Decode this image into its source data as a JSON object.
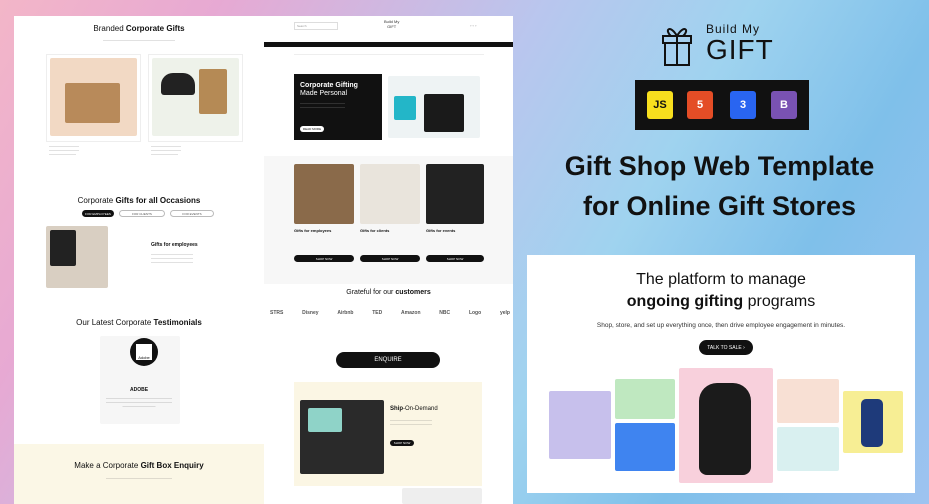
{
  "left_page": {
    "branded_title_a": "Branded",
    "branded_title_b": "Corporate Gifts",
    "occasions_title_a": "Corporate",
    "occasions_title_b": "Gifts for all Occasions",
    "occasion_tabs": [
      "FOR EMPLOYEES",
      "FOR CLIENTS",
      "FOR EVENTS"
    ],
    "employees_title": "Gifts for employees",
    "testimonials_title_a": "Our Latest Corporate",
    "testimonials_title_b": "Testimonials",
    "testimonial_company": "ADOBE",
    "testimonial_logo_text": "Adobe",
    "enquiry_title_a": "Make a Corporate",
    "enquiry_title_b": "Gift Box Enquiry"
  },
  "mid_page": {
    "search_placeholder": "Search",
    "logo_text_a": "Build My",
    "logo_text_b": "GIFT",
    "hero_title_a": "Corporate Gifting",
    "hero_title_b": "Made Personal",
    "hero_button": "READ MORE",
    "categories": [
      {
        "title": "Gifts for employees",
        "button": "SHOP NOW"
      },
      {
        "title": "Gifts for clients",
        "button": "SHOP NOW"
      },
      {
        "title": "Gifts for events",
        "button": "SHOP NOW"
      }
    ],
    "customers_title_a": "Grateful for our",
    "customers_title_b": "customers",
    "customer_logos": [
      "STRS",
      "Disney",
      "Airbnb",
      "TED",
      "Amazon",
      "NBC",
      "Logo",
      "yelp"
    ],
    "enquire_button": "ENQUIRE",
    "ship_title_a": "Ship",
    "ship_title_b": "-On-Demand",
    "ship_button": "SHOP NOW"
  },
  "brand": {
    "line1": "Build My",
    "line2": "GIFT"
  },
  "tech_badges": [
    {
      "label": "JS",
      "color": "#f7df1e"
    },
    {
      "label": "5",
      "color": "#e44d26"
    },
    {
      "label": "3",
      "color": "#2965f1"
    },
    {
      "label": "B",
      "color": "#7952b3"
    }
  ],
  "headline": {
    "line1": "Gift Shop Web Template",
    "line2": "for Online Gift Stores"
  },
  "platform": {
    "title_line1": "The platform to manage",
    "title_line2_bold": "ongoing gifting",
    "title_line2_rest": "programs",
    "subtitle": "Shop, store, and set up everything once, then drive employee engagement in minutes.",
    "button": "TALK TO SALE"
  }
}
